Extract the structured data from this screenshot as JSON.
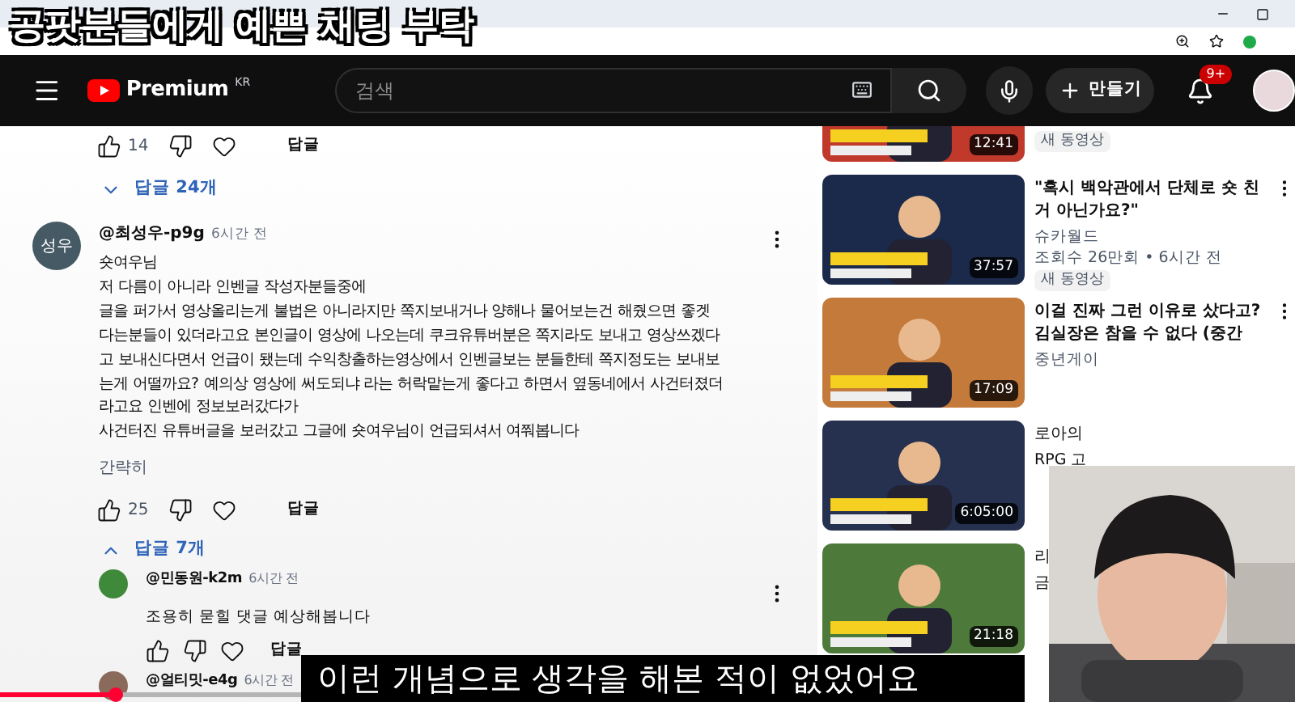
{
  "overlay_title": "공팟분들에게 예쁜 채팅 부탁",
  "header": {
    "logo": "Premium",
    "region": "KR",
    "search": {
      "placeholder": "검색"
    },
    "create": "만들기",
    "notifications": "9+"
  },
  "comments": {
    "top_actions": {
      "likes": "14",
      "reply": "답글"
    },
    "replies_toggle": {
      "label": "답글 24개",
      "expanded": false
    },
    "comment": {
      "avatar": "성우",
      "author": "@최성우-p9g",
      "time": "6시간 전",
      "lines": [
        "숏여우님",
        "저 다름이 아니라 인벤글 작성자분들중에",
        "글을 퍼가서 영상올리는게 불법은 아니라지만 쪽지보내거나 양해나 물어보는건 해줬으면 좋겟",
        "다는분들이 있더라고요 본인글이 영상에 나오는데 쿠크유튜버분은 쪽지라도 보내고 영상쓰겠다",
        "고 보내신다면서 언급이 됐는데 수익창출하는영상에서 인벤글보는 분들한테 쪽지정도는 보내보",
        "는게 어떨까요? 예의상 영상에 써도되냐 라는 허락맡는게 좋다고 하면서 옆동네에서 사건터졌더",
        "라고요 인벤에 정보보러갔다가",
        "사건터진 유튜버글을 보러갔고 그글에 숏여우님이 언급되셔서 여쭤봅니다"
      ],
      "collapse": "간략히",
      "likes": "25",
      "reply": "답글"
    },
    "replies_toggle_2": {
      "label": "답글 7개",
      "expanded": true
    },
    "replies": [
      {
        "author": "@민동원-k2m",
        "time": "6시간 전",
        "text": "조용히 묻힐 댓글 예상해봅니다",
        "reply": "답글",
        "color": "#3f8a3a"
      },
      {
        "author": "@얼티밋-e4g",
        "time": "6시간 전",
        "color": "#8a6a5a"
      }
    ]
  },
  "sidebar": [
    {
      "duration": "12:41",
      "badge": "새 동영상"
    },
    {
      "duration": "37:57",
      "title": "\"혹시 백악관에서 단체로 숏 친 거 아닌가요?\"",
      "channel": "슈카월드",
      "meta": "조회수 26만회 • 6시간 전",
      "badge": "새 동영상"
    },
    {
      "duration": "17:09",
      "title": "이걸 진짜 그런 이유로 샀다고? 김실장은 참을 수 없다 (중간",
      "channel": "중년게이"
    },
    {
      "duration": "6:05:00",
      "title": "로아의",
      "channel": "RPG 고"
    },
    {
      "duration": "21:18",
      "title": "리",
      "channel": "금"
    }
  ],
  "subtitle": "이런 개념으로 생각을 해본 적이 없었어요",
  "progress": {
    "level": 0.38
  }
}
